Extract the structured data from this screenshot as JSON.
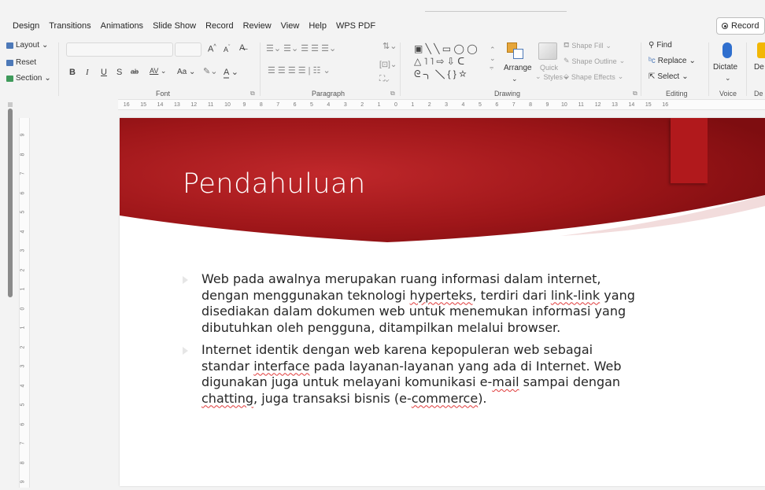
{
  "menu": [
    "Design",
    "Transitions",
    "Animations",
    "Slide Show",
    "Record",
    "Review",
    "View",
    "Help",
    "WPS PDF"
  ],
  "record_button": "Record",
  "slides_group": {
    "layout": "Layout",
    "reset": "Reset",
    "section": "Section"
  },
  "font_group": {
    "label": "Font",
    "size_up": "A",
    "size_down": "A",
    "bold": "B",
    "italic": "I",
    "underline": "U",
    "strike": "S",
    "spacing": "AV",
    "case": "Aa",
    "color": "A"
  },
  "paragraph_group": {
    "label": "Paragraph"
  },
  "drawing_group": {
    "label": "Drawing",
    "arrange": "Arrange",
    "quick_styles_1": "Quick",
    "quick_styles_2": "Styles",
    "shape_fill": "Shape Fill",
    "shape_outline": "Shape Outline",
    "shape_effects": "Shape Effects"
  },
  "editing_group": {
    "label": "Editing",
    "find": "Find",
    "replace": "Replace",
    "select": "Select"
  },
  "voice_group": {
    "label": "Voice",
    "dictate": "Dictate"
  },
  "designer_group": {
    "label": "De",
    "button": "De"
  },
  "ruler_h": [
    "16",
    "15",
    "14",
    "13",
    "12",
    "11",
    "10",
    "9",
    "8",
    "7",
    "6",
    "5",
    "4",
    "3",
    "2",
    "1",
    "0",
    "1",
    "2",
    "3",
    "4",
    "5",
    "6",
    "7",
    "8",
    "9",
    "10",
    "11",
    "12",
    "13",
    "14",
    "15",
    "16"
  ],
  "ruler_v": [
    "9",
    "8",
    "7",
    "6",
    "5",
    "4",
    "3",
    "2",
    "1",
    "0",
    "1",
    "2",
    "3",
    "4",
    "5",
    "6",
    "7",
    "8",
    "9"
  ],
  "slide": {
    "title": "Pendahuluan",
    "b1_l1": "Web pada awalnya merupakan ruang informasi dalam internet,",
    "b1_l2_a": "dengan menggunakan teknologi ",
    "b1_l2_b": "hyperteks",
    "b1_l2_c": ", terdiri dari ",
    "b1_l2_d": "link-link",
    "b1_l2_e": " yang",
    "b1_l3": "disediakan dalam dokumen web untuk menemukan informasi yang",
    "b1_l4": "dibutuhkan oleh pengguna, ditampilkan melalui browser.",
    "b2_l1": "Internet identik dengan web karena kepopuleran web sebagai",
    "b2_l2_a": "standar ",
    "b2_l2_b": "interface",
    "b2_l2_c": " pada layanan-layanan yang ada di Internet. Web",
    "b2_l3_a": "digunakan juga untuk melayani komunikasi e-",
    "b2_l3_b": "mail",
    "b2_l3_c": " sampai dengan",
    "b2_l4_a": "chatting",
    "b2_l4_b": ", juga transaksi bisnis (e-",
    "b2_l4_c": "commerce",
    "b2_l4_d": ")."
  },
  "colors": {
    "banner_dark": "#7e0d10",
    "banner_light": "#c0282b",
    "accent_tab": "#b1191c"
  }
}
